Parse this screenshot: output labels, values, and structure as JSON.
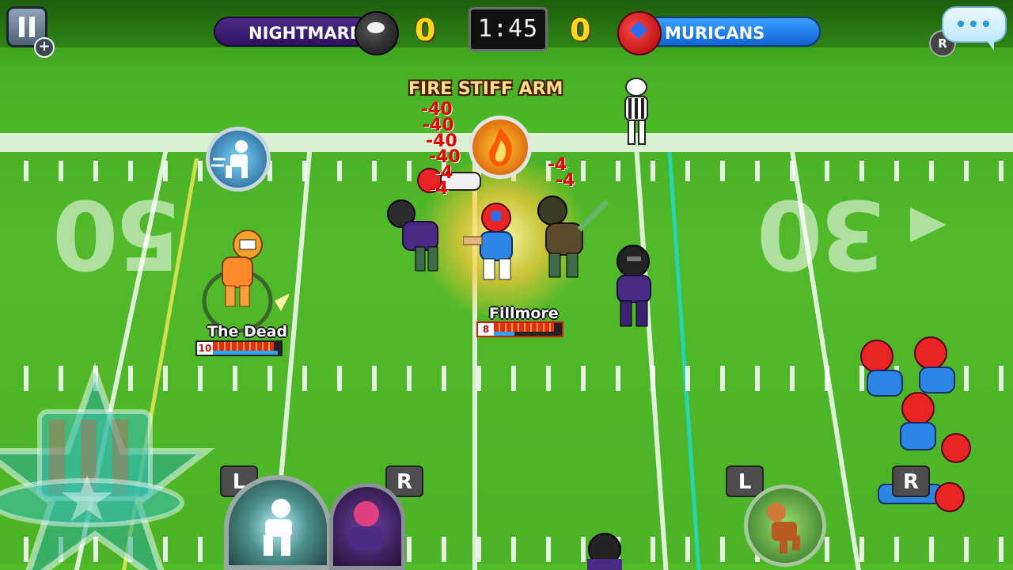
{
  "scoreboard": {
    "home_team": "NIGHTMARES",
    "home_score": "0",
    "away_team": "MURICANS",
    "away_score": "0",
    "clock": "1:45"
  },
  "field": {
    "yard_markers": [
      "50",
      "30"
    ]
  },
  "combat": {
    "move_name": "FIRE STIFF ARM",
    "damage_popups": [
      "-40",
      "-40",
      "-40",
      "-40",
      "-4",
      "-4",
      "-4",
      "-4"
    ]
  },
  "players": {
    "left": {
      "name": "The Dead",
      "level": "10",
      "health": 0.9,
      "stamina": 0.95
    },
    "center": {
      "name": "Fillmore",
      "level": "8",
      "health": 0.88,
      "stamina": 0.3
    }
  },
  "controls": {
    "left_key": "L",
    "right_key": "R",
    "left_key_2": "L",
    "right_key_2": "R",
    "replay_key": "R"
  },
  "colors": {
    "home": "#3b1f70",
    "away": "#1f7ee8",
    "score": "#ffd81a"
  },
  "icons": {
    "pause": "pause-icon",
    "chat": "chat-bubble-icon",
    "replay": "replay-icon"
  }
}
